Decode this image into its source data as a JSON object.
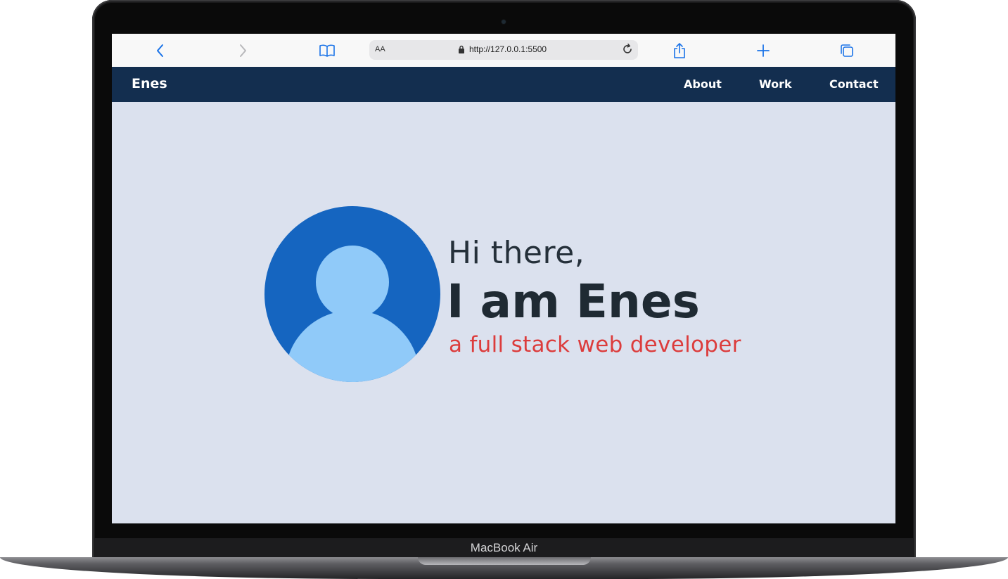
{
  "device": {
    "label": "MacBook Air"
  },
  "browser": {
    "address_left": "AA",
    "url": "http://127.0.0.1:5500"
  },
  "site": {
    "brand": "Enes",
    "nav": [
      "About",
      "Work",
      "Contact"
    ]
  },
  "hero": {
    "greeting": "Hi there,",
    "name": "I am Enes",
    "role": "a full stack web developer"
  },
  "colors": {
    "nav_bg": "#132e4f",
    "page_bg": "#dbe1ee",
    "accent_red": "#dc3c3c",
    "avatar_dark": "#1565c0",
    "avatar_light": "#90caf9",
    "browser_blue": "#1a73e8"
  },
  "icons": {
    "back": "chevron-left-icon",
    "forward": "chevron-right-icon",
    "bookmarks": "book-icon",
    "lock": "lock-icon",
    "reload": "reload-icon",
    "share": "share-icon",
    "new_tab": "plus-icon",
    "tabs": "tabs-icon"
  }
}
